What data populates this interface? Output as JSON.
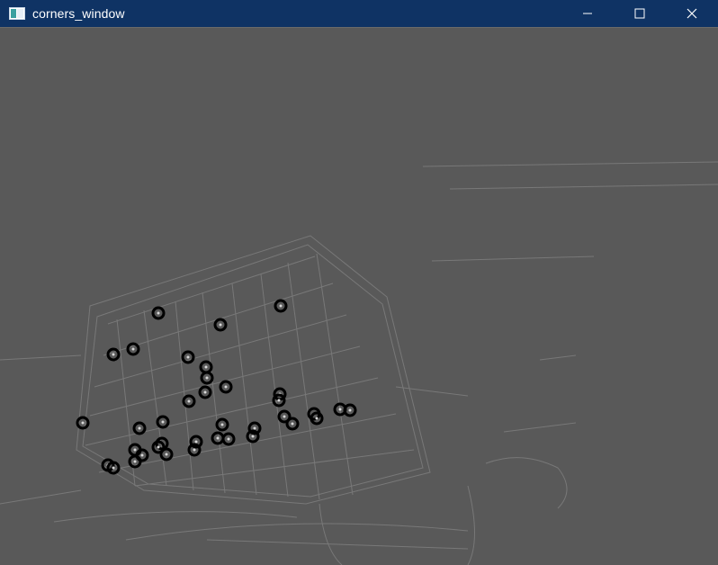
{
  "window": {
    "title": "corners_window",
    "app_icon": "opencv-window-icon",
    "controls": [
      "minimize-icon",
      "maximize-icon",
      "close-icon"
    ],
    "titlebar_color": "#0f3364",
    "title_color": "#ffffff"
  },
  "image": {
    "description_icon": "gradient-image",
    "background_color": "#595959",
    "edge_color": "#8a8a8a",
    "marker_color": "#000000",
    "marker_center_color": "#d8d8d8"
  }
}
